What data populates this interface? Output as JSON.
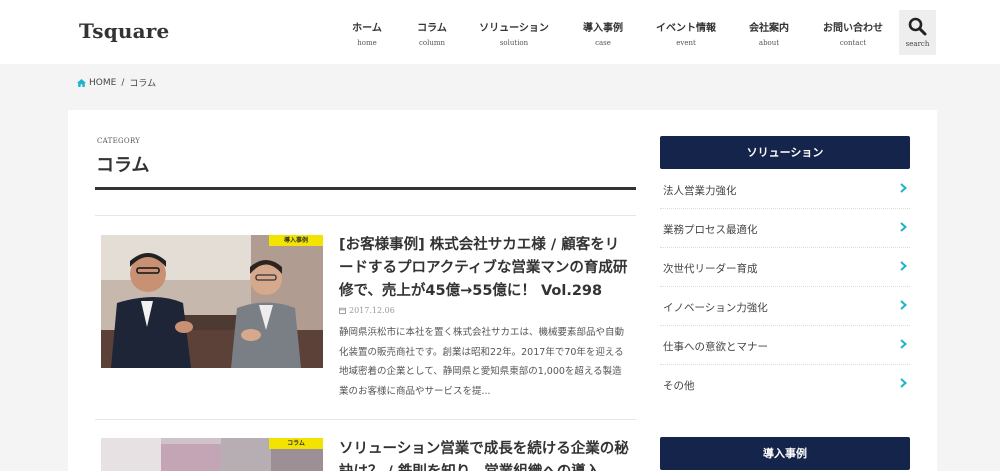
{
  "header": {
    "logo": "Tsquare",
    "nav": [
      {
        "ja": "ホーム",
        "en": "home"
      },
      {
        "ja": "コラム",
        "en": "column"
      },
      {
        "ja": "ソリューション",
        "en": "solution"
      },
      {
        "ja": "導入事例",
        "en": "case"
      },
      {
        "ja": "イベント情報",
        "en": "event"
      },
      {
        "ja": "会社案内",
        "en": "about"
      },
      {
        "ja": "お問い合わせ",
        "en": "contact"
      }
    ],
    "search": {
      "label": "search",
      "icon": "search-icon"
    }
  },
  "breadcrumb": {
    "home": "HOME",
    "separator": "/",
    "current": "コラム"
  },
  "category": {
    "label": "CATEGORY",
    "title": "コラム"
  },
  "posts": [
    {
      "badge": "導入事例",
      "title": "[お客様事例] 株式会社サカエ様 / 顧客をリードするプロアクティブな営業マンの育成研修で、売上が45億→55億に！ Vol.298",
      "date": "2017.12.06",
      "excerpt": "静岡県浜松市に本社を置く株式会社サカエは、機械要素部品や自動化装置の販売商社です。創業は昭和22年。2017年で70年を迎える地域密着の企業として、静岡県と愛知県東部の1,000を超える製造業のお客様に商品やサービスを提..."
    },
    {
      "badge": "コラム",
      "title": "ソリューション営業で成長を続ける企業の秘訣は？ / 鉄則を知り、営業組織への導入"
    }
  ],
  "sidebar": {
    "solution_heading": "ソリューション",
    "items": [
      "法人営業力強化",
      "業務プロセス最適化",
      "次世代リーダー育成",
      "イノベーション力強化",
      "仕事への意欲とマナー",
      "その他"
    ],
    "case_heading": "導入事例"
  },
  "colors": {
    "navy": "#14244a",
    "accent_teal": "#1bb4c9",
    "badge_yellow": "#f2e300"
  }
}
